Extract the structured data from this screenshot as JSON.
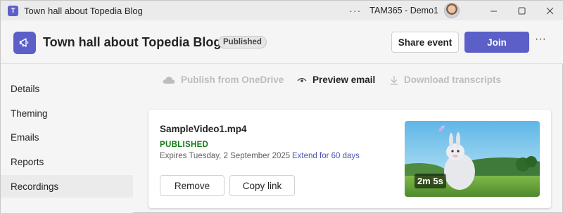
{
  "window": {
    "title": "Town hall about Topedia Blog",
    "account": "TAM365 - Demo1",
    "more_label": "···"
  },
  "header": {
    "event_title": "Town hall about Topedia Blog",
    "status": "Published",
    "share_label": "Share event",
    "join_label": "Join",
    "more_label": "···"
  },
  "sidebar": {
    "items": [
      {
        "label": "Details"
      },
      {
        "label": "Theming"
      },
      {
        "label": "Emails"
      },
      {
        "label": "Reports"
      },
      {
        "label": "Recordings"
      }
    ],
    "active": "Recordings"
  },
  "toolbar": {
    "publish_label": "Publish from OneDrive",
    "preview_label": "Preview email",
    "download_label": "Download transcripts"
  },
  "recording": {
    "file_name": "SampleVideo1.mp4",
    "status": "PUBLISHED",
    "expires": "Expires Tuesday, 2 September 2025",
    "extend_label": "Extend for 60 days",
    "duration": "2m 5s",
    "remove_label": "Remove",
    "copy_label": "Copy link"
  },
  "colors": {
    "brand": "#5b5fc7",
    "published": "#107c10",
    "link": "#4f52b2"
  },
  "icons": {
    "app": "teams-icon",
    "event": "megaphone-icon",
    "publish": "cloud-icon",
    "preview": "eye-icon",
    "download": "download-icon"
  }
}
